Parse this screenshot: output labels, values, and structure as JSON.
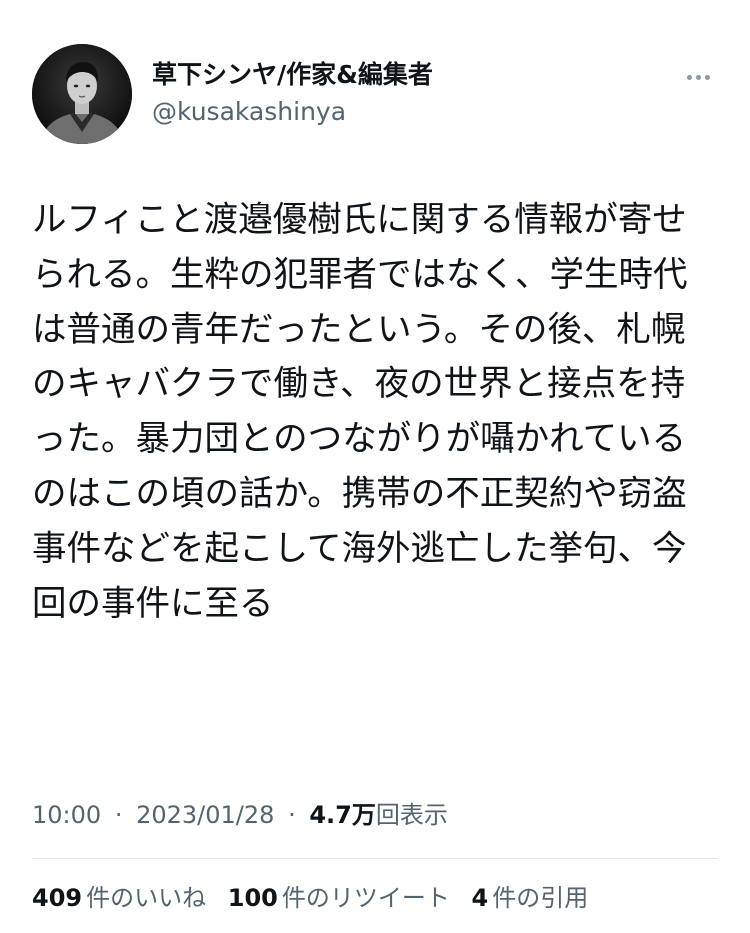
{
  "author": {
    "display_name": "草下シンヤ/作家&編集者",
    "handle": "@kusakashinya"
  },
  "tweet": {
    "text": "ルフィこと渡邉優樹氏に関する情報が寄せられる。生粋の犯罪者ではなく、学生時代は普通の青年だったという。その後、札幌のキャバクラで働き、夜の世界と接点を持った。暴力団とのつながりが囁かれているのはこの頃の話か。携帯の不正契約や窃盗事件などを起こして海外逃亡した挙句、今回の事件に至る"
  },
  "meta": {
    "time": "10:00",
    "separator": "·",
    "date": "2023/01/28",
    "views_count": "4.7万",
    "views_label": "回表示"
  },
  "stats": {
    "likes_count": "409",
    "likes_label": "件のいいね",
    "retweets_count": "100",
    "retweets_label": "件のリツイート",
    "quotes_count": "4",
    "quotes_label": "件の引用"
  },
  "icons": {
    "more": "more-horizontal-icon",
    "avatar": "profile-photo"
  },
  "colors": {
    "text_primary": "#0f1419",
    "text_secondary": "#536471",
    "divider": "#e6e9eb"
  }
}
